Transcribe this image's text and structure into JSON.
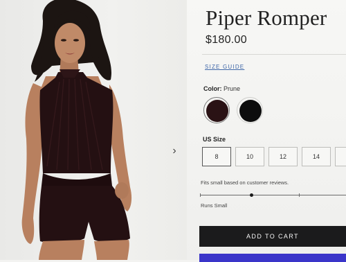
{
  "product": {
    "title": "Piper Romper",
    "price": "$180.00"
  },
  "size_guide_label": "SIZE GUIDE",
  "color": {
    "label": "Color:",
    "selected_value": "Prune",
    "swatches": [
      {
        "name": "Prune",
        "hex": "#2a1215"
      },
      {
        "name": "Black",
        "hex": "#0d0d0d"
      }
    ]
  },
  "sizes": {
    "label": "US Size",
    "options": [
      "8",
      "10",
      "12",
      "14"
    ],
    "selected": "8"
  },
  "fit": {
    "note": "Fits small based on customer reviews.",
    "result": "Runs Small",
    "position_fraction": 0.35
  },
  "cart": {
    "add_label": "ADD TO CART"
  },
  "icons": {
    "next": "chevron-right-icon"
  },
  "colors": {
    "accent_link": "#3f67a8",
    "cart_button": "#1b1b1c",
    "pay_button": "#3a35c9"
  }
}
